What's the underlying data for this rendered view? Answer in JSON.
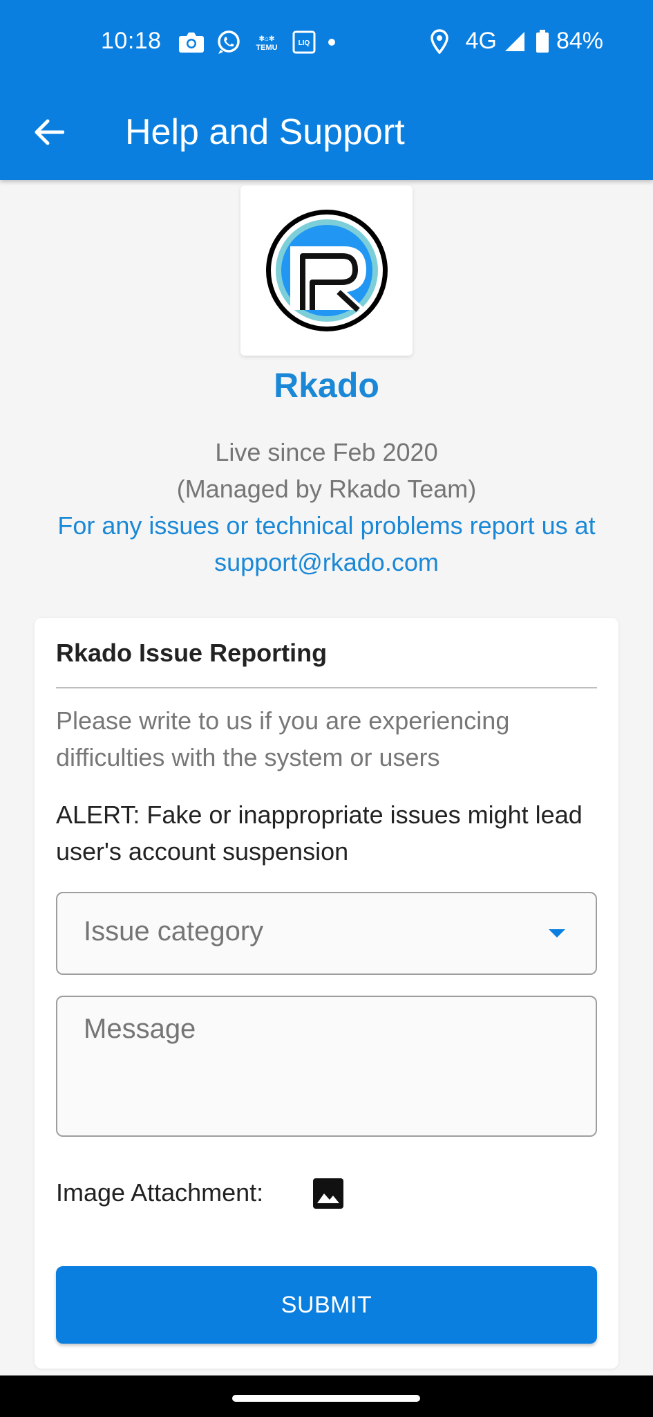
{
  "status_bar": {
    "time": "10:18",
    "network": "4G",
    "battery": "84%",
    "icons_left": [
      "camera-icon",
      "whatsapp-icon",
      "temu-icon",
      "liq-icon",
      "notification-dot-icon"
    ],
    "icons_right": [
      "location-icon",
      "signal-icon",
      "battery-icon"
    ]
  },
  "app_bar": {
    "title": "Help and Support",
    "back_icon": "arrow-back-icon"
  },
  "brand": {
    "name": "Rkado",
    "live_since": "Live since Feb 2020",
    "managed_by": "(Managed by Rkado Team)",
    "support_line_1": "For any issues or technical problems report us at",
    "support_line_2": "support@rkado.com"
  },
  "form": {
    "title": "Rkado Issue Reporting",
    "description": "Please write to us if you are experiencing difficulties with the system or users",
    "alert": "ALERT: Fake or inappropriate issues might lead user's account suspension",
    "category_placeholder": "Issue category",
    "message_placeholder": "Message",
    "attachment_label": "Image Attachment:",
    "submit_label": "SUBMIT"
  },
  "colors": {
    "primary": "#0a7fe0",
    "brand_text": "#1a88d6",
    "background": "#f5f5f5"
  }
}
